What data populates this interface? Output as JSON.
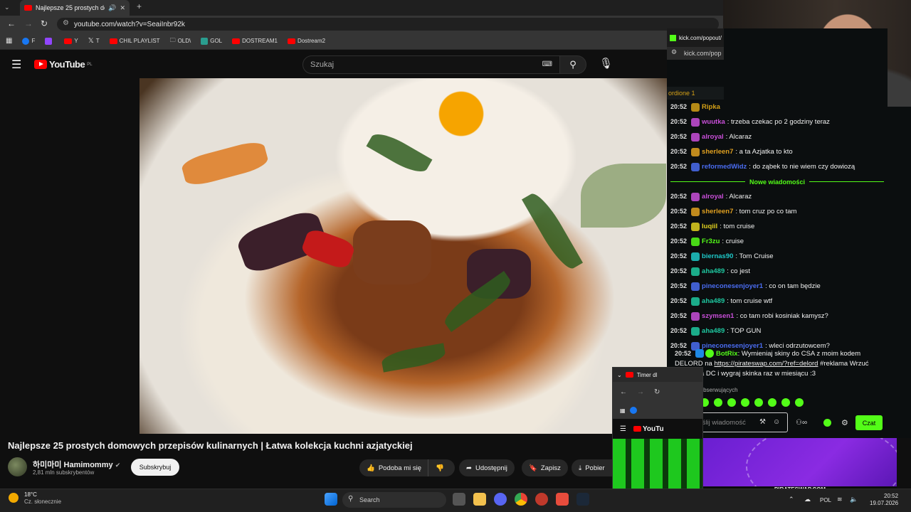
{
  "browser": {
    "tab_title": "Najlepsze 25 prostych dom",
    "url": "youtube.com/watch?v=SeaiInbr92k",
    "bookmarks": [
      "F",
      "",
      "Y",
      "T",
      "CHIL PLAYLIST",
      "OLD\\",
      "GOL",
      "DOSTREAM1",
      "Dostream2"
    ]
  },
  "youtube": {
    "logo": "YouTube",
    "region": "PL",
    "search_placeholder": "Szukaj",
    "video_title": "Najlepsze 25 prostych domowych przepisów kulinarnych  |  Łatwa kolekcja kuchni azjatyckiej",
    "channel_name": "하미마미 Hamimommy",
    "channel_subs": "2,81 mln subskrybentów",
    "subscribe_label": "Subskrybuj",
    "actions": [
      "Podoba mi się",
      "",
      "Udostępnij",
      "Zapisz",
      "Pobier"
    ]
  },
  "kick": {
    "window_title": "kick.com/popout/",
    "url": "kick.com/pop",
    "pinned": "ordione 1",
    "messages_before": [
      {
        "time": "20:52",
        "user": "Ripka",
        "color": "#d4a017",
        "text": ""
      },
      {
        "time": "20:52",
        "user": "wuutka",
        "color": "#c94fd9",
        "text": ": trzeba czekac po 2 godziny teraz"
      },
      {
        "time": "20:52",
        "user": "alroyal",
        "color": "#c94fd9",
        "text": ": Alcaraz"
      },
      {
        "time": "20:52",
        "user": "sherleen7",
        "color": "#e0a020",
        "text": ": a ta Azjatka to kto"
      },
      {
        "time": "20:52",
        "user": "reformedWidz",
        "color": "#4a6cf0",
        "text": ": do ząbek to nie wiem czy dowiozą"
      }
    ],
    "new_messages_label": "Nowe wiadomości",
    "messages_after": [
      {
        "time": "20:52",
        "user": "alroyal",
        "color": "#c94fd9",
        "text": ": Alcaraz"
      },
      {
        "time": "20:52",
        "user": "sherleen7",
        "color": "#e0a020",
        "text": ": tom cruz po co tam"
      },
      {
        "time": "20:52",
        "user": "luqiil",
        "color": "#e0d020",
        "text": ": tom cruise"
      },
      {
        "time": "20:52",
        "user": "Fr3zu",
        "color": "#53fc18",
        "text": ": cruise"
      },
      {
        "time": "20:52",
        "user": "biernas90",
        "color": "#1ec8c8",
        "text": ": Tom Cruise"
      },
      {
        "time": "20:52",
        "user": "aha489",
        "color": "#1ec8a0",
        "text": ": co jest"
      },
      {
        "time": "20:52",
        "user": "pineconesenjoyer1",
        "color": "#4a6cf0",
        "text": ": co on tam będzie"
      },
      {
        "time": "20:52",
        "user": "aha489",
        "color": "#1ec8a0",
        "text": ": tom cruise wtf"
      },
      {
        "time": "20:52",
        "user": "szymsen1",
        "color": "#c94fd9",
        "text": ": co tam robi kosiniak kamysz?"
      },
      {
        "time": "20:52",
        "user": "aha489",
        "color": "#1ec8a0",
        "text": ": TOP GUN"
      },
      {
        "time": "20:52",
        "user": "pineconesenjoyer1",
        "color": "#4a6cf0",
        "text": ": wleci odrzutowcem?"
      }
    ],
    "bot": {
      "time": "20:52",
      "user": "BotRix",
      "text1": ": Wymieniaj skiny do CSA z moim kodem DELORD na ",
      "link": "https://pirateswap.com/?ref=delord",
      "text2": " #reklama Wrzuć dowód na DC i wygraj skinka raz w miesiącu :3"
    },
    "followers_only": "Tylko dla obserwujących",
    "input_placeholder": "Wyślij wiadomość",
    "send_label": "Czat"
  },
  "popup": {
    "title": "Timer dl",
    "logo": "YouTu"
  },
  "ad": {
    "site": "PIRATESWAP.COM"
  },
  "taskbar": {
    "temp": "18°C",
    "weather": "Cz. słonecznie",
    "search": "Search",
    "lang": "POL",
    "time": "20:52",
    "date": "19.07.2026"
  }
}
